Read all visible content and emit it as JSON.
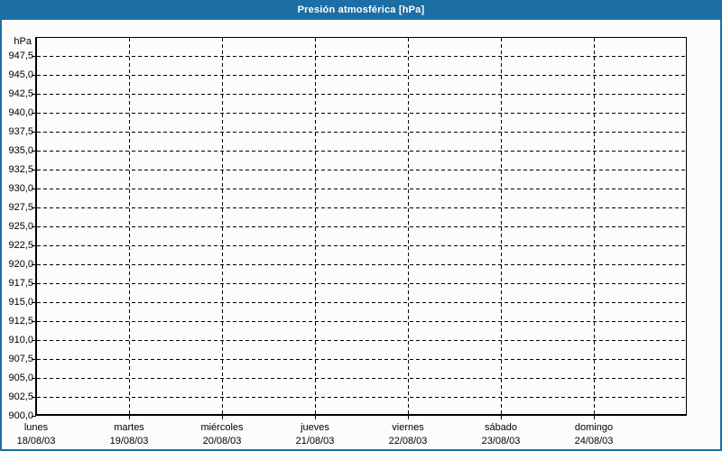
{
  "title_bar": {
    "title": "Presión atmosférica [hPa]"
  },
  "y_axis": {
    "unit_label": "hPa",
    "tick_labels": [
      "947,5",
      "945,0",
      "942,5",
      "940,0",
      "937,5",
      "935,0",
      "932,5",
      "930,0",
      "927,5",
      "925,0",
      "922,5",
      "920,0",
      "917,5",
      "915,0",
      "912,5",
      "910,0",
      "907,5",
      "905,0",
      "902,5",
      "900,0"
    ]
  },
  "x_axis": {
    "days": [
      {
        "name": "lunes",
        "date": "18/08/03"
      },
      {
        "name": "martes",
        "date": "19/08/03"
      },
      {
        "name": "miércoles",
        "date": "20/08/03"
      },
      {
        "name": "jueves",
        "date": "21/08/03"
      },
      {
        "name": "viernes",
        "date": "22/08/03"
      },
      {
        "name": "sábado",
        "date": "23/08/03"
      },
      {
        "name": "domingo",
        "date": "24/08/03"
      }
    ]
  },
  "colors": {
    "frame_blue": "#1c6ea4",
    "background": "#fcfdfb",
    "grid_black": "#000000",
    "text_black": "#000000",
    "title_text": "#ffffff"
  },
  "chart_data": {
    "type": "line",
    "title": "Presión atmosférica [hPa]",
    "xlabel": "",
    "ylabel": "hPa",
    "ylim": [
      900.0,
      950.0
    ],
    "ytick_interval": 2.5,
    "yticks": [
      947.5,
      945.0,
      942.5,
      940.0,
      937.5,
      935.0,
      932.5,
      930.0,
      927.5,
      925.0,
      922.5,
      920.0,
      917.5,
      915.0,
      912.5,
      910.0,
      907.5,
      905.0,
      902.5,
      900.0
    ],
    "x_categories": [
      "lunes 18/08/03",
      "martes 19/08/03",
      "miércoles 20/08/03",
      "jueves 21/08/03",
      "viernes 22/08/03",
      "sábado 23/08/03",
      "domingo 24/08/03"
    ],
    "series": [],
    "grid": "dashed",
    "legend_position": "none",
    "note": "Empty chart grid: no pressure data points are plotted for the week shown."
  }
}
